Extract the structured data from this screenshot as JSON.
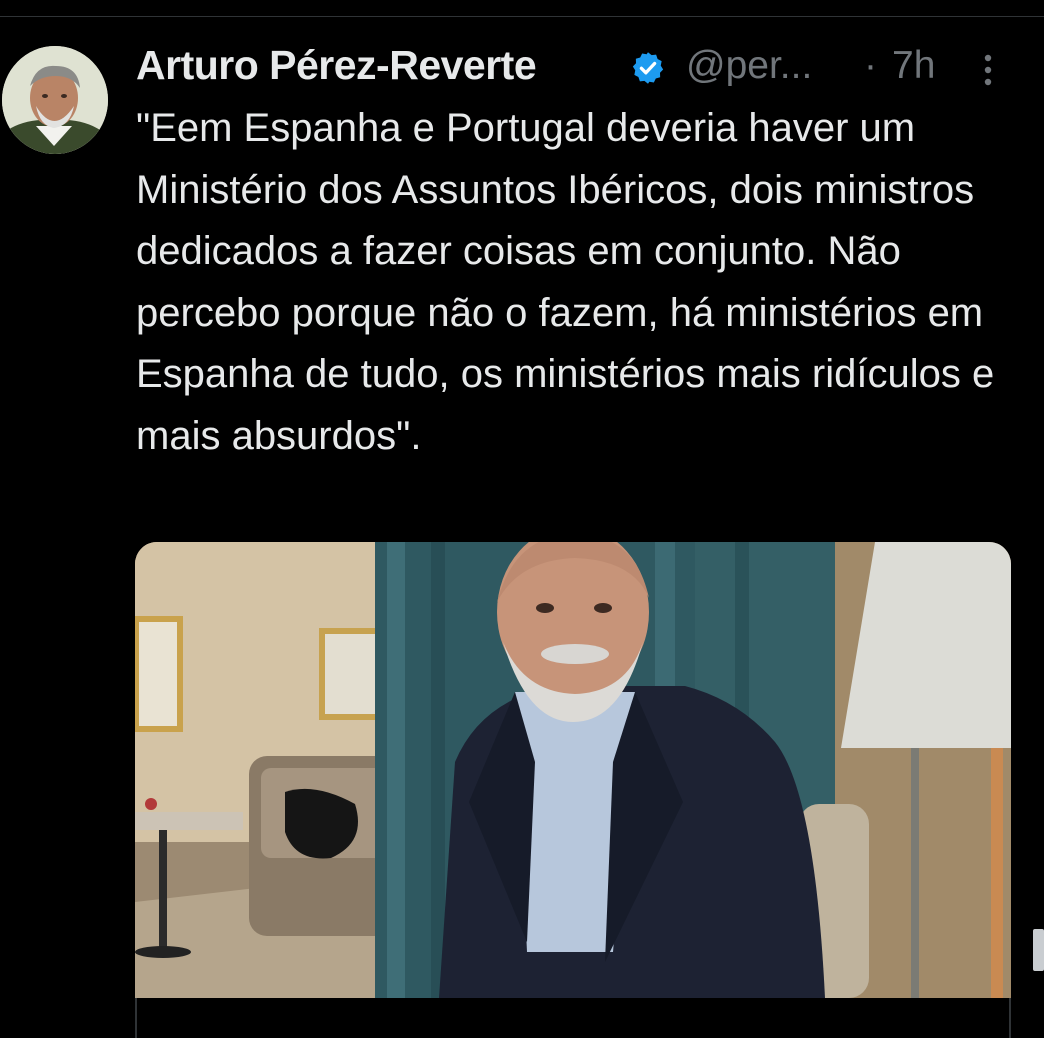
{
  "tweet": {
    "author_name": "Arturo Pérez-Reverte",
    "handle": "@per...",
    "separator": "·",
    "time": "7h",
    "text": "\"Eem Espanha e Portugal deveria haver um Ministério dos Assuntos Ibéricos, dois ministros dedicados a fazer coisas em conjunto. Não percebo porque não o fazem, há ministérios em Espanha de tudo, os ministérios mais ridículos e mais absurdos\"."
  },
  "icons": {
    "verified": "verified-badge-icon",
    "more": "more-vertical-icon"
  },
  "colors": {
    "background": "#000000",
    "text": "#e7e9ea",
    "secondary": "#71767b",
    "verified": "#1d9bf0"
  }
}
